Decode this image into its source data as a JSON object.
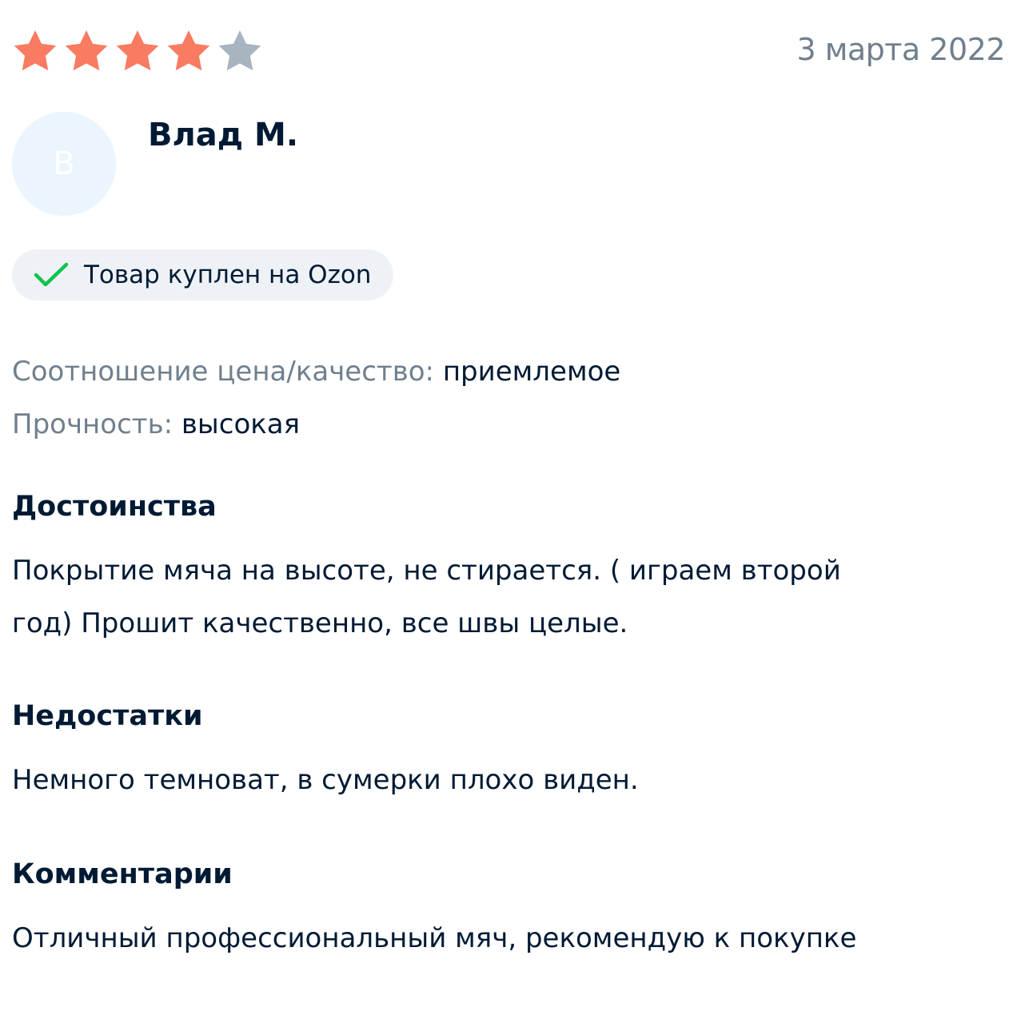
{
  "review": {
    "rating": 4,
    "max_rating": 5,
    "colors": {
      "star_filled": "#f97b62",
      "star_empty": "#a8b4c0",
      "check": "#10c44c",
      "text_primary": "#001a34",
      "text_secondary": "#707f8d",
      "avatar_bg": "#eaf5fd",
      "badge_bg": "#eef2f6"
    },
    "date": "3 марта 2022",
    "author": {
      "initial": "В",
      "name": "Влад М."
    },
    "badge": {
      "icon": "check-icon",
      "label": "Товар куплен на Ozon"
    },
    "properties": [
      {
        "key": "Соотношение цена/качество:",
        "value": "приемлемое"
      },
      {
        "key": "Прочность:",
        "value": "высокая"
      }
    ],
    "sections": {
      "advantages": {
        "title": "Достоинства",
        "lines": [
          "Покрытие мяча на высоте, не стирается. ( играем второй",
          "год) Прошит качественно, все швы целые."
        ]
      },
      "disadvantages": {
        "title": "Недостатки",
        "text": "Немного темноват, в сумерки плохо виден."
      },
      "comments": {
        "title": "Комментарии",
        "text": "Отличный профессиональный мяч, рекомендую к покупке"
      }
    }
  }
}
